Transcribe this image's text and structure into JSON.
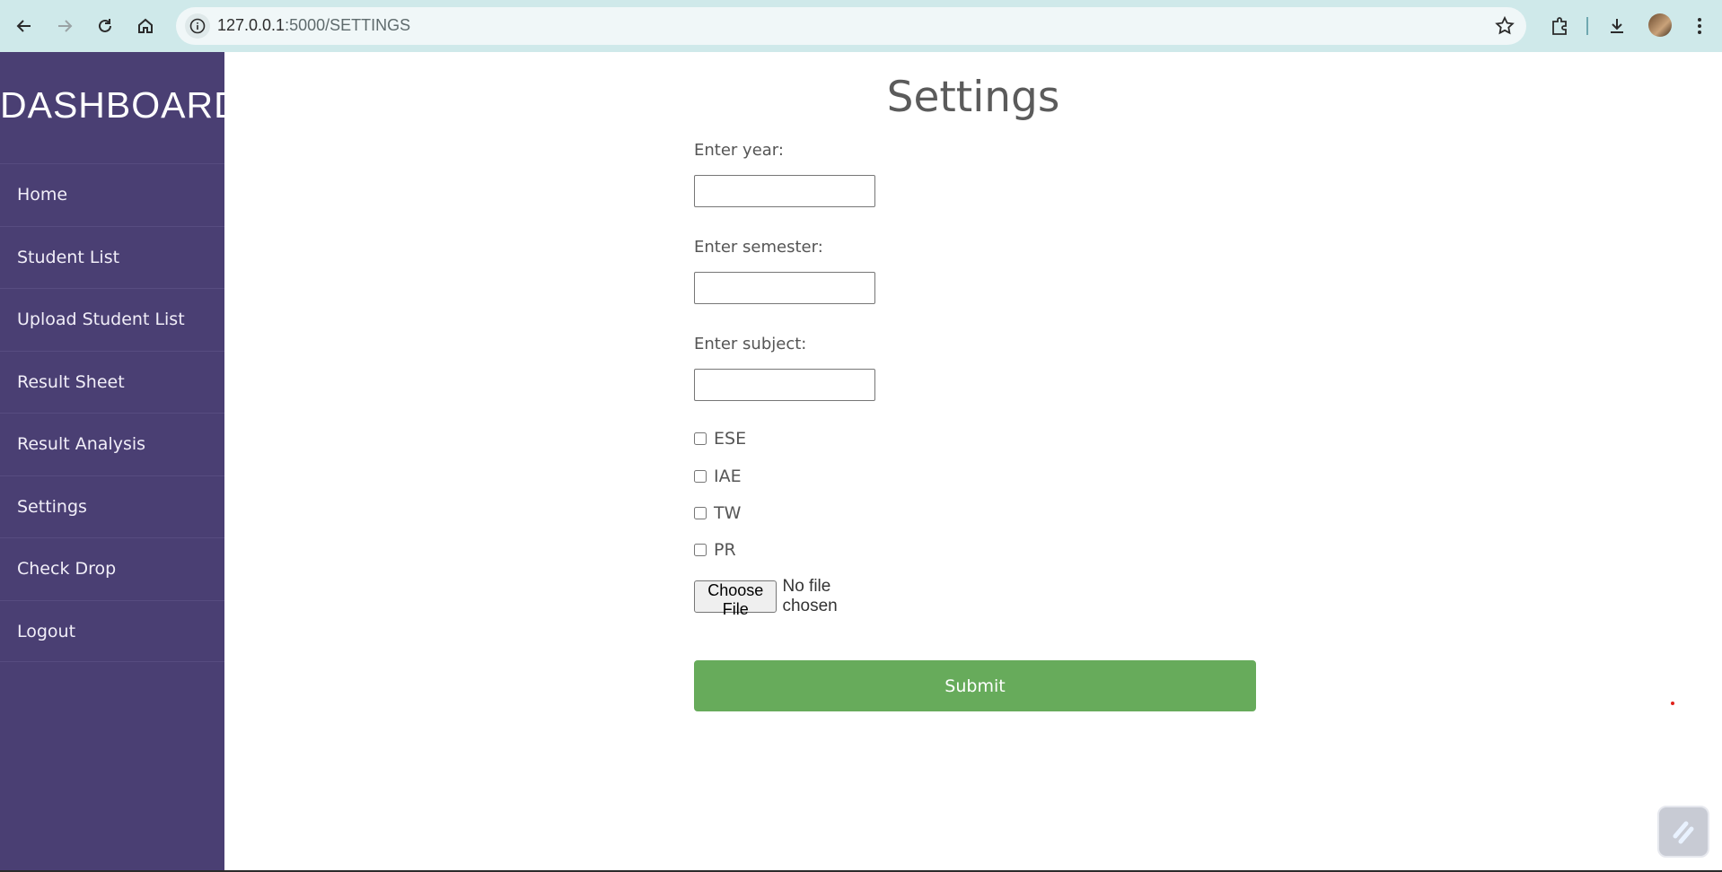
{
  "browser": {
    "url_host": "127.0.0.1",
    "url_path": ":5000/SETTINGS"
  },
  "sidebar": {
    "brand": "DASHBOARD",
    "items": [
      {
        "label": "Home"
      },
      {
        "label": "Student List"
      },
      {
        "label": "Upload Student List"
      },
      {
        "label": "Result Sheet"
      },
      {
        "label": "Result Analysis"
      },
      {
        "label": "Settings"
      },
      {
        "label": "Check Drop"
      },
      {
        "label": "Logout"
      }
    ]
  },
  "main": {
    "title": "Settings",
    "fields": {
      "year_label": "Enter year:",
      "year_value": "",
      "semester_label": "Enter semester:",
      "semester_value": "",
      "subject_label": "Enter subject:",
      "subject_value": ""
    },
    "checkboxes": [
      {
        "label": "ESE",
        "checked": false
      },
      {
        "label": "IAE",
        "checked": false
      },
      {
        "label": "TW",
        "checked": false
      },
      {
        "label": "PR",
        "checked": false
      }
    ],
    "file": {
      "button_label": "Choose File",
      "status": "No file chosen"
    },
    "submit_label": "Submit"
  },
  "colors": {
    "sidebar_bg": "#4a3f73",
    "submit_bg": "#67ab5b",
    "browser_bar": "#cfe9ea"
  }
}
